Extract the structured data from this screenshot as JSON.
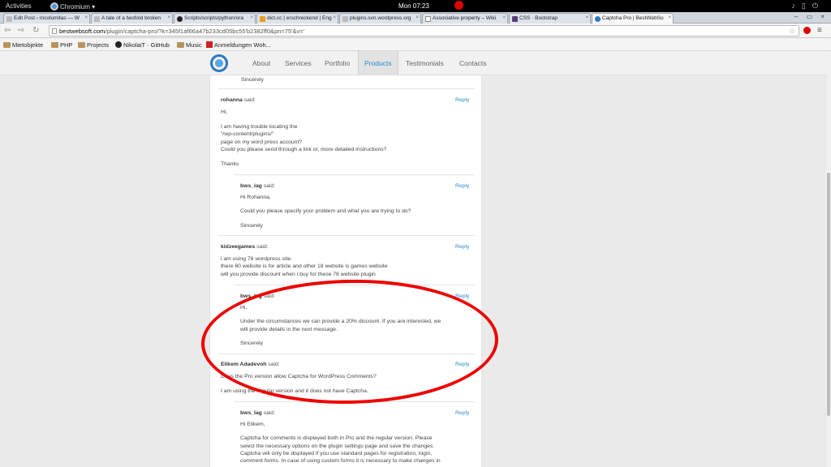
{
  "system": {
    "activities": "Activities",
    "app_menu": "Chromium ▾",
    "clock": "Mon 07:23"
  },
  "tabs": [
    {
      "title": "Edit Post ‹ Incolumitas — W"
    },
    {
      "title": "A tale of a twofold broken"
    },
    {
      "title": "Scripts/scripts/python/ora"
    },
    {
      "title": "dict.cc | erschreckend | Eng"
    },
    {
      "title": "plugins.svn.wordpress.org"
    },
    {
      "title": "Associative property – Wiki"
    },
    {
      "title": "CSS · Bootstrap"
    },
    {
      "title": "Captcha Pro | BestWebSo"
    }
  ],
  "omnibox": {
    "host": "bestwebsoft.com",
    "path": "/plugin/captcha-pro/?k=345f1af66a47b233cd05bc55'b2382ff0&pn=75'&v='"
  },
  "bookmarks": [
    "Mietobjekte",
    "PHP",
    "Projects",
    "NikolaiT · GitHub",
    "Music",
    "Anmeldungen Woh..."
  ],
  "site_nav": [
    "About",
    "Services",
    "Portfolio",
    "Products",
    "Testimonials",
    "Contacts"
  ],
  "comments": {
    "c0": {
      "signoff": "Sincerely"
    },
    "c1": {
      "author": "rohanna",
      "said": "said:",
      "reply": "Reply",
      "lines": [
        "Hi,",
        "I am having trouble locating the",
        "\"/wp-content/plugins/\"",
        "page on my word press account?",
        "Could you please send through a link or, more detailed instructions?",
        "Thanks"
      ]
    },
    "c2": {
      "author": "bws_lag",
      "said": "said:",
      "reply": "Reply",
      "lines": [
        "Hi Rohanna,",
        "Could you please specify your problem and what you are trying to do?",
        "Sincerely"
      ]
    },
    "c3": {
      "author": "kidzeegames",
      "said": "said:",
      "reply": "Reply",
      "lines": [
        "i am using 78 wordpress site.",
        "there 60 website is for article and other 18 website is games website",
        "will you provide discount when i buy for these 78 website plugin"
      ]
    },
    "c4": {
      "author": "bws_lag",
      "said": "said:",
      "reply": "Reply",
      "lines": [
        "Hi,",
        "Under the circumstances we can provide a 20% discount. If you are interested, we",
        "will provide details in the next message.",
        "Sincerely"
      ]
    },
    "c5": {
      "author": "Elikem Adadevoh",
      "said": "said:",
      "reply": "Reply",
      "lines": [
        "Does the Pro version allow Captcha for WordPress Comments?",
        "I am using the regular version and it does not have Captcha."
      ]
    },
    "c6": {
      "author": "bws_lag",
      "said": "said:",
      "reply": "Reply",
      "lines": [
        "Hi Elikem,",
        "Captcha for comments is displayed both in Pro and the regular version. Please",
        "select the necessary options on the plugin settings page and save the changes.",
        "Captcha will only be displayed if you use standard pages for registration, login,",
        "comment forms. In case of using custom forms it is necessary to make changes in"
      ]
    }
  }
}
